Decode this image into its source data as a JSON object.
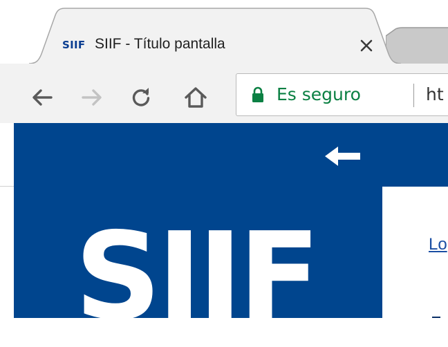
{
  "browser": {
    "tab": {
      "favicon_text": "SIIF",
      "title": "SIIF - Título pantalla",
      "close_symbol": "×"
    },
    "toolbar": {
      "back_icon": "arrow-left-icon",
      "forward_icon": "arrow-right-icon",
      "reload_icon": "reload-icon",
      "home_icon": "home-icon"
    },
    "omnibox": {
      "lock_icon": "lock-icon",
      "security_label": "Es seguro",
      "url_prefix": "ht"
    }
  },
  "app": {
    "brand_color": "#00458e",
    "secure_color": "#0b8043",
    "sidebar": {
      "collapse_icon": "arrow-left-icon",
      "logo_text": "SIIF"
    },
    "content": {
      "link_text": "Lo"
    }
  }
}
